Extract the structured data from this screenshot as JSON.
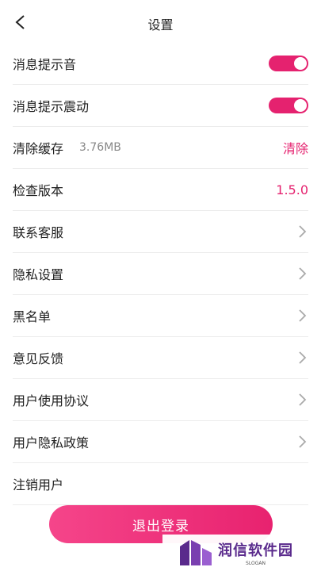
{
  "header": {
    "title": "设置"
  },
  "rows": [
    {
      "label": "消息提示音",
      "type": "toggle",
      "on": true
    },
    {
      "label": "消息提示震动",
      "type": "toggle",
      "on": true
    },
    {
      "label": "清除缓存",
      "sub": "3.76MB",
      "type": "action",
      "action_label": "清除"
    },
    {
      "label": "检查版本",
      "type": "value",
      "value": "1.5.0"
    },
    {
      "label": "联系客服",
      "type": "link"
    },
    {
      "label": "隐私设置",
      "type": "link"
    },
    {
      "label": "黑名单",
      "type": "link"
    },
    {
      "label": "意见反馈",
      "type": "link"
    },
    {
      "label": "用户使用协议",
      "type": "link"
    },
    {
      "label": "用户隐私政策",
      "type": "link"
    },
    {
      "label": "注销用户",
      "type": "plain"
    }
  ],
  "logout": {
    "label": "退出登录"
  },
  "watermark": {
    "name": "润信软件园",
    "slogan": "SLOGAN"
  },
  "colors": {
    "accent": "#e5226f",
    "brand": "#5a2a8c"
  }
}
